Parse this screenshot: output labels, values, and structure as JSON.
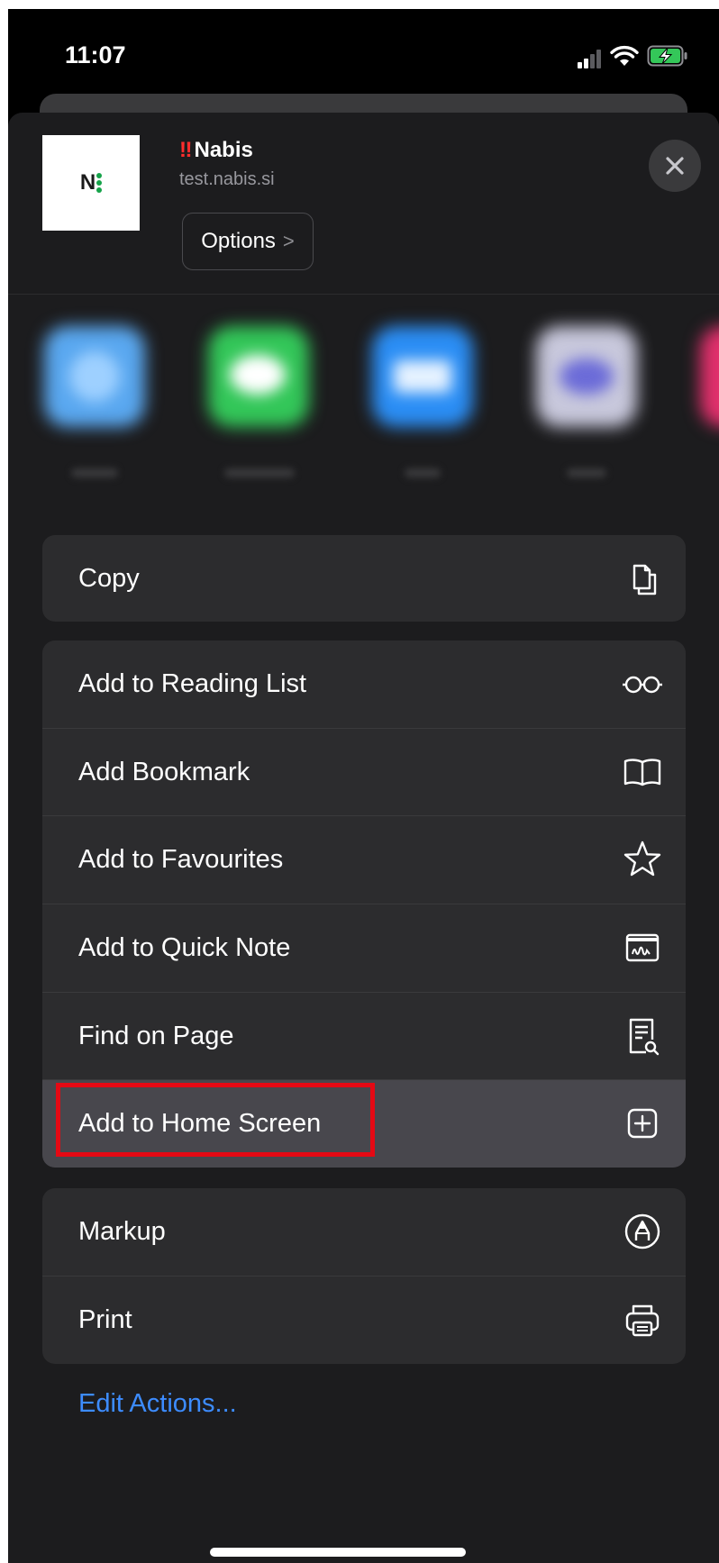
{
  "status_bar": {
    "time": "11:07",
    "icons": [
      "cellular-signal-icon",
      "wifi-icon",
      "battery-charging-icon"
    ]
  },
  "share_header": {
    "thumbnail_text": "N",
    "title_prefix": "‼",
    "title": "Nabis",
    "url": "test.nabis.si",
    "options_label": "Options",
    "options_chevron": ">",
    "close_icon": "close-icon"
  },
  "app_row": {
    "apps": [
      {
        "icon": "airdrop-app-icon",
        "color": "#5aa8f0"
      },
      {
        "icon": "messages-app-icon",
        "color": "#33c759"
      },
      {
        "icon": "mail-app-icon",
        "color": "#2b8ef5"
      },
      {
        "icon": "app-icon",
        "color": "#c8c8dc"
      },
      {
        "icon": "instagram-app-icon",
        "color": "#e1306c"
      }
    ]
  },
  "actions": {
    "group1": [
      {
        "label": "Copy",
        "icon": "copy-icon"
      }
    ],
    "group2": [
      {
        "label": "Add to Reading List",
        "icon": "glasses-icon"
      },
      {
        "label": "Add Bookmark",
        "icon": "book-icon"
      },
      {
        "label": "Add to Favourites",
        "icon": "star-icon"
      },
      {
        "label": "Add to Quick Note",
        "icon": "quick-note-icon"
      },
      {
        "label": "Find on Page",
        "icon": "find-on-page-icon"
      },
      {
        "label": "Add to Home Screen",
        "icon": "plus-square-icon"
      }
    ],
    "group3": [
      {
        "label": "Markup",
        "icon": "markup-pen-icon"
      },
      {
        "label": "Print",
        "icon": "printer-icon"
      }
    ]
  },
  "edit_actions_label": "Edit Actions...",
  "colors": {
    "sheet_background": "#1c1c1e",
    "row_background": "#2c2c2e",
    "highlight_row": "#48474d",
    "annotation_red": "#e50914",
    "link_blue": "#3d8cff"
  }
}
